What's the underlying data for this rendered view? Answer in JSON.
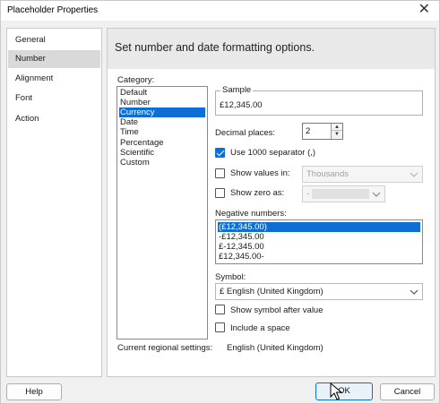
{
  "window": {
    "title": "Placeholder Properties",
    "close_icon": "close-icon"
  },
  "nav": {
    "items": [
      "General",
      "Number",
      "Alignment",
      "Font",
      "Action"
    ],
    "selected": "Number"
  },
  "panel": {
    "title": "Set number and date formatting options."
  },
  "category": {
    "label": "Category:",
    "items": [
      "Default",
      "Number",
      "Currency",
      "Date",
      "Time",
      "Percentage",
      "Scientific",
      "Custom"
    ],
    "selected": "Currency"
  },
  "sample": {
    "label": "Sample",
    "value": "£12,345.00"
  },
  "decimal_places": {
    "label": "Decimal places:",
    "value": "2"
  },
  "use_separator": {
    "label": "Use 1000 separator (,)",
    "checked": true
  },
  "show_values_in": {
    "label": "Show values in:",
    "checked": false,
    "value": "Thousands"
  },
  "show_zero_as": {
    "label": "Show zero as:",
    "checked": false,
    "value": "-"
  },
  "negative_numbers": {
    "label": "Negative numbers:",
    "items": [
      "(£12,345.00)",
      "-£12,345.00",
      "£-12,345.00",
      "£12,345.00-"
    ],
    "selected": "(£12,345.00)"
  },
  "symbol": {
    "label": "Symbol:",
    "value": "£ English (United Kingdom)"
  },
  "symbol_after": {
    "label": "Show symbol after value",
    "checked": false
  },
  "include_space": {
    "label": "Include a space",
    "checked": false
  },
  "regional": {
    "label": "Current regional settings:",
    "value": "English (United Kingdom)"
  },
  "buttons": {
    "help": "Help",
    "ok": "OK",
    "cancel": "Cancel"
  },
  "colors": {
    "accent": "#0d6fd6",
    "selection": "#0d6fd6",
    "nav_selected": "#d9d9d9"
  }
}
